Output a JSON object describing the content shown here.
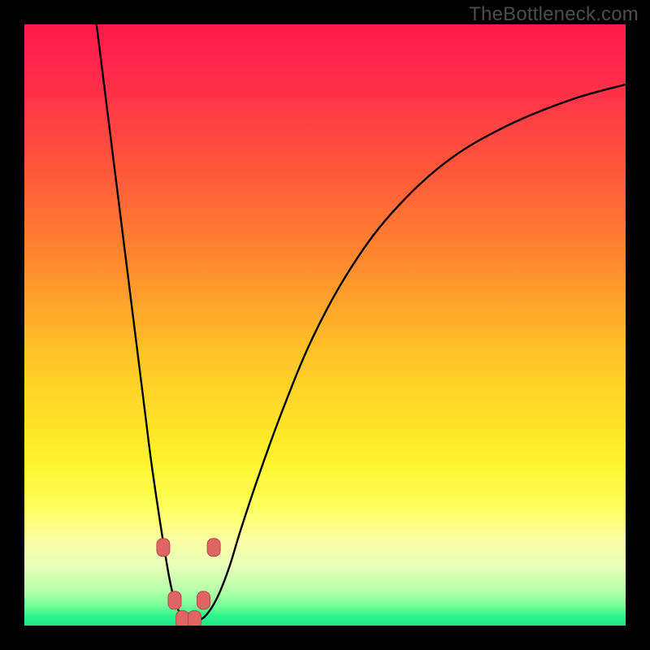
{
  "watermark": "TheBottleneck.com",
  "colors": {
    "black": "#000000",
    "curve": "#000000",
    "marker_fill": "#e06666",
    "marker_stroke": "#b44848",
    "gradient_stops": [
      {
        "offset": 0.0,
        "color": "#ff1a4d"
      },
      {
        "offset": 0.1,
        "color": "#ff2e4a"
      },
      {
        "offset": 0.25,
        "color": "#ff5a3a"
      },
      {
        "offset": 0.4,
        "color": "#ff8c2e"
      },
      {
        "offset": 0.55,
        "color": "#ffc427"
      },
      {
        "offset": 0.72,
        "color": "#fff22a"
      },
      {
        "offset": 0.8,
        "color": "#feff5a"
      },
      {
        "offset": 0.86,
        "color": "#fbffa6"
      },
      {
        "offset": 0.9,
        "color": "#e8ffb8"
      },
      {
        "offset": 0.94,
        "color": "#b8ffac"
      },
      {
        "offset": 0.965,
        "color": "#7fff9c"
      },
      {
        "offset": 0.985,
        "color": "#2bf58b"
      },
      {
        "offset": 1.0,
        "color": "#1fe584"
      }
    ]
  },
  "chart_data": {
    "type": "line",
    "title": "",
    "xlabel": "",
    "ylabel": "",
    "xlim": [
      0,
      100
    ],
    "ylim": [
      0,
      100
    ],
    "grid": false,
    "series": [
      {
        "name": "left-branch",
        "x": [
          12,
          14,
          16,
          18,
          20,
          21,
          22,
          23,
          24,
          24.7,
          25.3,
          26.5,
          28
        ],
        "y": [
          100,
          84,
          68,
          52,
          36,
          28,
          21,
          14.5,
          8.5,
          5.2,
          3.2,
          1.3,
          0.5
        ]
      },
      {
        "name": "right-branch",
        "x": [
          28,
          30,
          32,
          34,
          36,
          39,
          43,
          48,
          54,
          61,
          70,
          80,
          91,
          100
        ],
        "y": [
          0.5,
          1.5,
          4.5,
          9.5,
          16,
          25,
          36,
          48,
          59,
          68.5,
          77,
          83,
          87.5,
          90
        ]
      }
    ],
    "markers": {
      "name": "highlight-dots",
      "points": [
        {
          "x": 23.1,
          "y": 13.0
        },
        {
          "x": 31.5,
          "y": 13.0
        },
        {
          "x": 25.0,
          "y": 4.2
        },
        {
          "x": 29.8,
          "y": 4.2
        },
        {
          "x": 26.3,
          "y": 1.0
        },
        {
          "x": 28.3,
          "y": 1.0
        }
      ]
    }
  }
}
